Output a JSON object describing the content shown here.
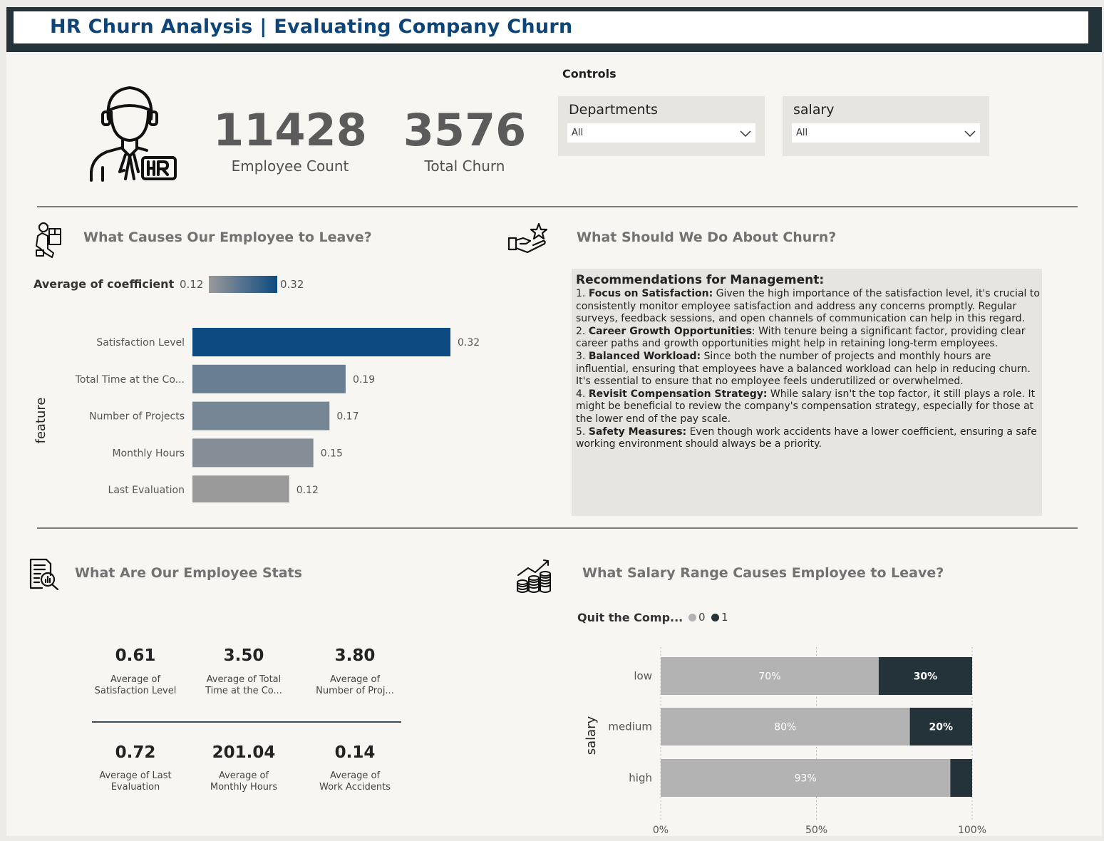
{
  "header": {
    "title": "HR Churn Analysis | Evaluating Company Churn"
  },
  "kpis": {
    "employee_count": {
      "value": "11428",
      "label": "Employee Count"
    },
    "total_churn": {
      "value": "3576",
      "label": "Total Churn"
    }
  },
  "controls": {
    "title": "Controls",
    "departments": {
      "label": "Departments",
      "value": "All"
    },
    "salary": {
      "label": "salary",
      "value": "All"
    }
  },
  "icons": {
    "hr_avatar": "hr-person-icon",
    "causes": "person-box-icon",
    "recommend": "hand-star-icon",
    "stats": "document-search-icon",
    "salary": "coins-growth-icon",
    "dropdown": "chevron-down-icon"
  },
  "causes": {
    "title": "What Causes Our Employee to Leave?",
    "legend": {
      "label": "Average of coefficient",
      "min": "0.12",
      "max": "0.32"
    }
  },
  "recommendations": {
    "title": "What Should We Do About Churn?",
    "heading": "Recommendations for Management:",
    "items": [
      {
        "num": "1.",
        "title": "Focus on Satisfaction:",
        "text": " Given the high importance of the satisfaction level, it's crucial to consistently monitor employee satisfaction and address any concerns promptly. Regular surveys, feedback sessions, and open channels of communication can help in this regard."
      },
      {
        "num": "2.",
        "title": "Career Growth Opportunities",
        "text": ": With tenure being a significant factor, providing clear career paths and growth opportunities might help in retaining long-term employees."
      },
      {
        "num": "3.",
        "title": "Balanced Workload:",
        "text": " Since both the number of projects and monthly hours are influential, ensuring that employees have a balanced workload can help in reducing churn. It's essential to ensure that no employee feels underutilized or overwhelmed."
      },
      {
        "num": "4.",
        "title": "Revisit Compensation Strategy:",
        "text": " While salary isn't the top factor, it still plays a role. It might be beneficial to review the company's compensation strategy, especially for those at the lower end of the pay scale."
      },
      {
        "num": "5.",
        "title": "Safety Measures:",
        "text": " Even though work accidents have a lower coefficient, ensuring a safe working environment should always be a priority."
      }
    ]
  },
  "stats": {
    "title": "What Are Our Employee Stats",
    "cards": [
      {
        "value": "0.61",
        "label1": "Average of",
        "label2": "Satisfaction Level"
      },
      {
        "value": "3.50",
        "label1": "Average of Total",
        "label2": "Time at the Co..."
      },
      {
        "value": "3.80",
        "label1": "Average of",
        "label2": "Number of Proj..."
      },
      {
        "value": "0.72",
        "label1": "Average of Last",
        "label2": "Evaluation"
      },
      {
        "value": "201.04",
        "label1": "Average of",
        "label2": "Monthly Hours"
      },
      {
        "value": "0.14",
        "label1": "Average of",
        "label2": "Work Accidents"
      }
    ]
  },
  "salary_section": {
    "title": "What Salary Range Causes Employee to Leave?",
    "legend_title": "Quit the Comp...",
    "legend_items": [
      "0",
      "1"
    ]
  },
  "colors": {
    "title_blue": "#0e4579",
    "header_dark": "#24323a",
    "bar_dark": "#233339",
    "bar_grey": "#b3b3b3",
    "coef_high": "#0d4a82",
    "coef_low": "#9a9a9a"
  },
  "chart_data": [
    {
      "type": "bar",
      "orientation": "horizontal",
      "categories": [
        "Satisfaction Level",
        "Total Time at the Co...",
        "Number of Projects",
        "Monthly Hours",
        "Last Evaluation"
      ],
      "values": [
        0.32,
        0.19,
        0.17,
        0.15,
        0.12
      ],
      "data_labels": [
        "0.32",
        "0.19",
        "0.17",
        "0.15",
        "0.12"
      ],
      "ylabel": "feature",
      "legend": "Average of coefficient",
      "color_scale": {
        "min": 0.12,
        "max": 0.32,
        "min_color": "#9a9a9a",
        "max_color": "#0d4a82"
      }
    },
    {
      "type": "bar",
      "orientation": "horizontal",
      "stacked": "percent",
      "categories": [
        "low",
        "medium",
        "high"
      ],
      "series": [
        {
          "name": "0",
          "values": [
            70,
            80,
            93
          ],
          "labels": [
            "70%",
            "80%",
            "93%"
          ],
          "color": "#b3b3b3"
        },
        {
          "name": "1",
          "values": [
            30,
            20,
            7
          ],
          "labels": [
            "30%",
            "20%",
            ""
          ],
          "color": "#233339"
        }
      ],
      "ylabel": "salary",
      "xticks": [
        "0%",
        "50%",
        "100%"
      ],
      "xlim": [
        0,
        100
      ],
      "legend_title": "Quit the Comp...",
      "grid": true
    }
  ]
}
